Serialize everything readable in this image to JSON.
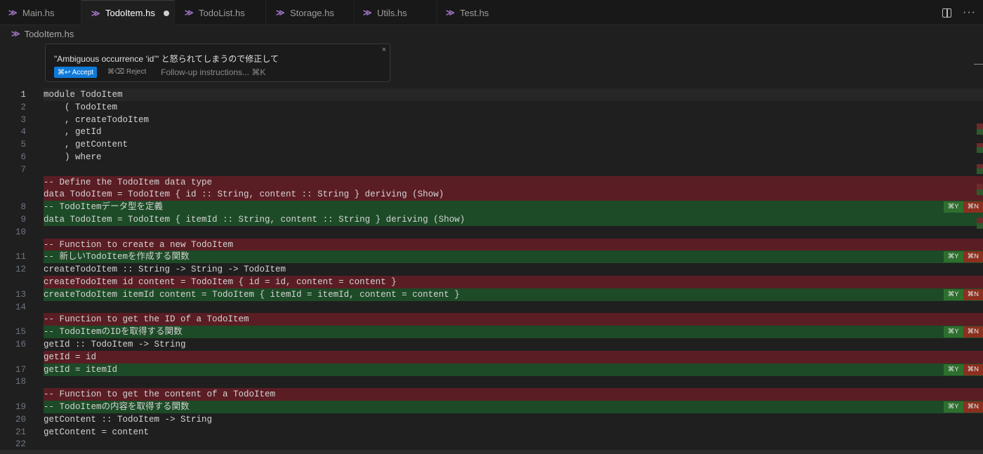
{
  "tabs": [
    {
      "label": "Main.hs",
      "active": false,
      "dirty": false
    },
    {
      "label": "TodoItem.hs",
      "active": true,
      "dirty": true
    },
    {
      "label": "TodoList.hs",
      "active": false,
      "dirty": false
    },
    {
      "label": "Storage.hs",
      "active": false,
      "dirty": false
    },
    {
      "label": "Utils.hs",
      "active": false,
      "dirty": false
    },
    {
      "label": "Test.hs",
      "active": false,
      "dirty": false
    }
  ],
  "tab_icon_glyph": "≫",
  "actions": {
    "more": "···"
  },
  "breadcrumb": {
    "file": "TodoItem.hs"
  },
  "ai_widget": {
    "prompt": "\"Ambiguous occurrence ‘id’\" と怒られてしまうので修正して",
    "close": "×",
    "accept_label": "⌘↩ Accept",
    "reject_label": "⌘⌫ Reject",
    "followup_placeholder": "Follow-up instructions... ⌘K"
  },
  "keys": {
    "accept": "⌘Y",
    "reject": "⌘N"
  },
  "colors": {
    "removed_bg": "#5b1d24",
    "added_bg": "#1d4b27",
    "accent": "#0f7ad8",
    "haskell_icon": "#a074c4"
  },
  "lines": [
    {
      "num": "1",
      "text": "module TodoItem",
      "type": "normal",
      "current": true
    },
    {
      "num": "2",
      "text": "    ( TodoItem",
      "type": "normal"
    },
    {
      "num": "3",
      "text": "    , createTodoItem",
      "type": "normal"
    },
    {
      "num": "4",
      "text": "    , getId",
      "type": "normal"
    },
    {
      "num": "5",
      "text": "    , getContent",
      "type": "normal"
    },
    {
      "num": "6",
      "text": "    ) where",
      "type": "normal"
    },
    {
      "num": "7",
      "text": "",
      "type": "normal"
    },
    {
      "num": "",
      "text": "-- Define the TodoItem data type",
      "type": "removed"
    },
    {
      "num": "",
      "text": "data TodoItem = TodoItem { id :: String, content :: String } deriving (Show)",
      "type": "removed"
    },
    {
      "num": "8",
      "text": "-- TodoItemデータ型を定義",
      "type": "added",
      "keys": true
    },
    {
      "num": "9",
      "text": "data TodoItem = TodoItem { itemId :: String, content :: String } deriving (Show)",
      "type": "added"
    },
    {
      "num": "10",
      "text": "",
      "type": "normal"
    },
    {
      "num": "",
      "text": "-- Function to create a new TodoItem",
      "type": "removed"
    },
    {
      "num": "11",
      "text": "-- 新しいTodoItemを作成する関数",
      "type": "added",
      "keys": true
    },
    {
      "num": "12",
      "text": "createTodoItem :: String -> String -> TodoItem",
      "type": "normal"
    },
    {
      "num": "",
      "text": "createTodoItem id content = TodoItem { id = id, content = content }",
      "type": "removed"
    },
    {
      "num": "13",
      "text": "createTodoItem itemId content = TodoItem { itemId = itemId, content = content }",
      "type": "added",
      "keys": true
    },
    {
      "num": "14",
      "text": "",
      "type": "normal"
    },
    {
      "num": "",
      "text": "-- Function to get the ID of a TodoItem",
      "type": "removed"
    },
    {
      "num": "15",
      "text": "-- TodoItemのIDを取得する関数",
      "type": "added",
      "keys": true
    },
    {
      "num": "16",
      "text": "getId :: TodoItem -> String",
      "type": "normal"
    },
    {
      "num": "",
      "text": "getId = id",
      "type": "removed"
    },
    {
      "num": "17",
      "text": "getId = itemId",
      "type": "added",
      "keys": true
    },
    {
      "num": "18",
      "text": "",
      "type": "normal"
    },
    {
      "num": "",
      "text": "-- Function to get the content of a TodoItem",
      "type": "removed"
    },
    {
      "num": "19",
      "text": "-- TodoItemの内容を取得する関数",
      "type": "added",
      "keys": true
    },
    {
      "num": "20",
      "text": "getContent :: TodoItem -> String",
      "type": "normal"
    },
    {
      "num": "21",
      "text": "getContent = content",
      "type": "normal"
    },
    {
      "num": "22",
      "text": "",
      "type": "normal"
    }
  ]
}
